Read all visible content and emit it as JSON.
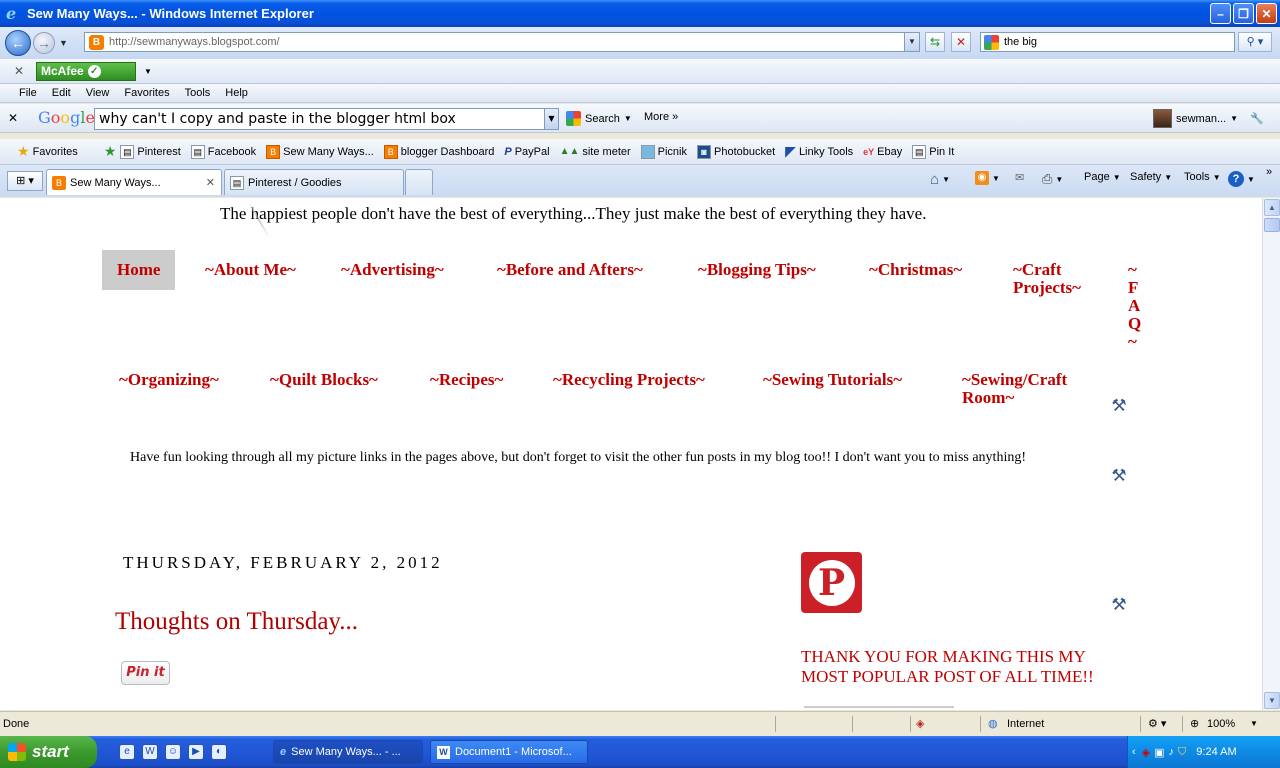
{
  "window": {
    "title": "Sew Many Ways... - Windows Internet Explorer"
  },
  "nav": {
    "url": "http://sewmanyways.blogspot.com/",
    "search_value": "the big"
  },
  "addon_bar": {
    "mcafee_label": "McAfee"
  },
  "menu": [
    "File",
    "Edit",
    "View",
    "Favorites",
    "Tools",
    "Help"
  ],
  "google_bar": {
    "logo": "Google",
    "query": "why can't I copy and paste in the blogger html box",
    "search_label": "Search",
    "more_label": "More",
    "user_label": "sewman..."
  },
  "favorites": {
    "label": "Favorites",
    "items": [
      "Pinterest",
      "Facebook",
      "Sew Many Ways...",
      "blogger Dashboard",
      "PayPal",
      "site meter",
      "Picnik",
      "Photobucket",
      "Linky Tools",
      "Ebay",
      "Pin It"
    ]
  },
  "tabs": [
    {
      "label": "Sew Many Ways..."
    },
    {
      "label": "Pinterest / Goodies"
    }
  ],
  "command_bar": {
    "page": "Page",
    "safety": "Safety",
    "tools": "Tools"
  },
  "page": {
    "quote": "The happiest people don't have the best of everything...They just make the best of everything they have.",
    "nav_row1": [
      "Home",
      "~About Me~",
      "~Advertising~",
      "~Before and Afters~",
      "~Blogging Tips~",
      "~Christmas~",
      "~Craft\nProjects~",
      "~\nF\nA\nQ\n~"
    ],
    "nav_row2": [
      "~Organizing~",
      "~Quilt Blocks~",
      "~Recipes~",
      "~Recycling Projects~",
      "~Sewing Tutorials~",
      "~Sewing/Craft\nRoom~"
    ],
    "fun_text": "Have fun looking through all my picture links in the pages above, but don't forget to visit the other fun posts in my blog too!! I don't want you to miss anything!",
    "date_header": "THURSDAY, FEBRUARY 2, 2012",
    "post_title": "Thoughts on Thursday...",
    "pinit_label": "Pin it",
    "thanks_text": "THANK YOU FOR MAKING THIS MY MOST POPULAR POST OF ALL TIME!!"
  },
  "status": {
    "text": "Done",
    "zone": "Internet",
    "zoom": "100%"
  },
  "taskbar": {
    "start_label": "start",
    "tasks": [
      "Sew Many Ways... - ...",
      "Document1 - Microsof..."
    ],
    "clock": "9:24 AM"
  }
}
